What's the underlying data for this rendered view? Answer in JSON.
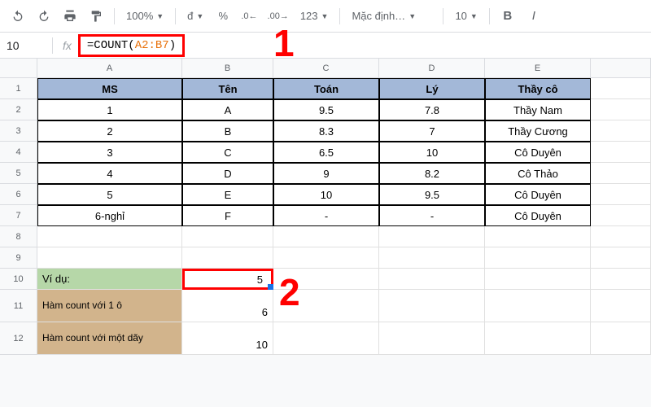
{
  "toolbar": {
    "zoom": "100%",
    "currency": "đ",
    "percent": "%",
    "dec_dec": ".0←",
    "dec_inc": ".00→",
    "num_format": "123",
    "font": "Mặc định…",
    "font_size": "10",
    "bold": "B",
    "italic": "I"
  },
  "formula_bar": {
    "name_box": "10",
    "fx": "fx",
    "prefix": "=COUNT(",
    "range": "A2:B7",
    "suffix": ")"
  },
  "columns": [
    "A",
    "B",
    "C",
    "D",
    "E"
  ],
  "row_numbers": [
    "1",
    "2",
    "3",
    "4",
    "5",
    "6",
    "7",
    "8",
    "9",
    "10",
    "11",
    "12"
  ],
  "headers": {
    "ms": "MS",
    "ten": "Tên",
    "toan": "Toán",
    "ly": "Lý",
    "thayco": "Thầy cô"
  },
  "rows": [
    {
      "ms": "1",
      "ten": "A",
      "toan": "9.5",
      "ly": "7.8",
      "thayco": "Thầy Nam"
    },
    {
      "ms": "2",
      "ten": "B",
      "toan": "8.3",
      "ly": "7",
      "thayco": "Thầy Cương"
    },
    {
      "ms": "3",
      "ten": "C",
      "toan": "6.5",
      "ly": "10",
      "thayco": "Cô Duyên"
    },
    {
      "ms": "4",
      "ten": "D",
      "toan": "9",
      "ly": "8.2",
      "thayco": "Cô Thảo"
    },
    {
      "ms": "5",
      "ten": "E",
      "toan": "10",
      "ly": "9.5",
      "thayco": "Cô Duyên"
    },
    {
      "ms": "6-nghỉ",
      "ten": "F",
      "toan": "-",
      "ly": "-",
      "thayco": "Cô Duyên"
    }
  ],
  "examples": {
    "r10a": "Ví dụ:",
    "r10b": "5",
    "r11a": "Hàm count với 1 ô",
    "r11b": "6",
    "r12a": "Hàm count với một dãy",
    "r12b": "10"
  },
  "callouts": {
    "one": "1",
    "two": "2"
  }
}
